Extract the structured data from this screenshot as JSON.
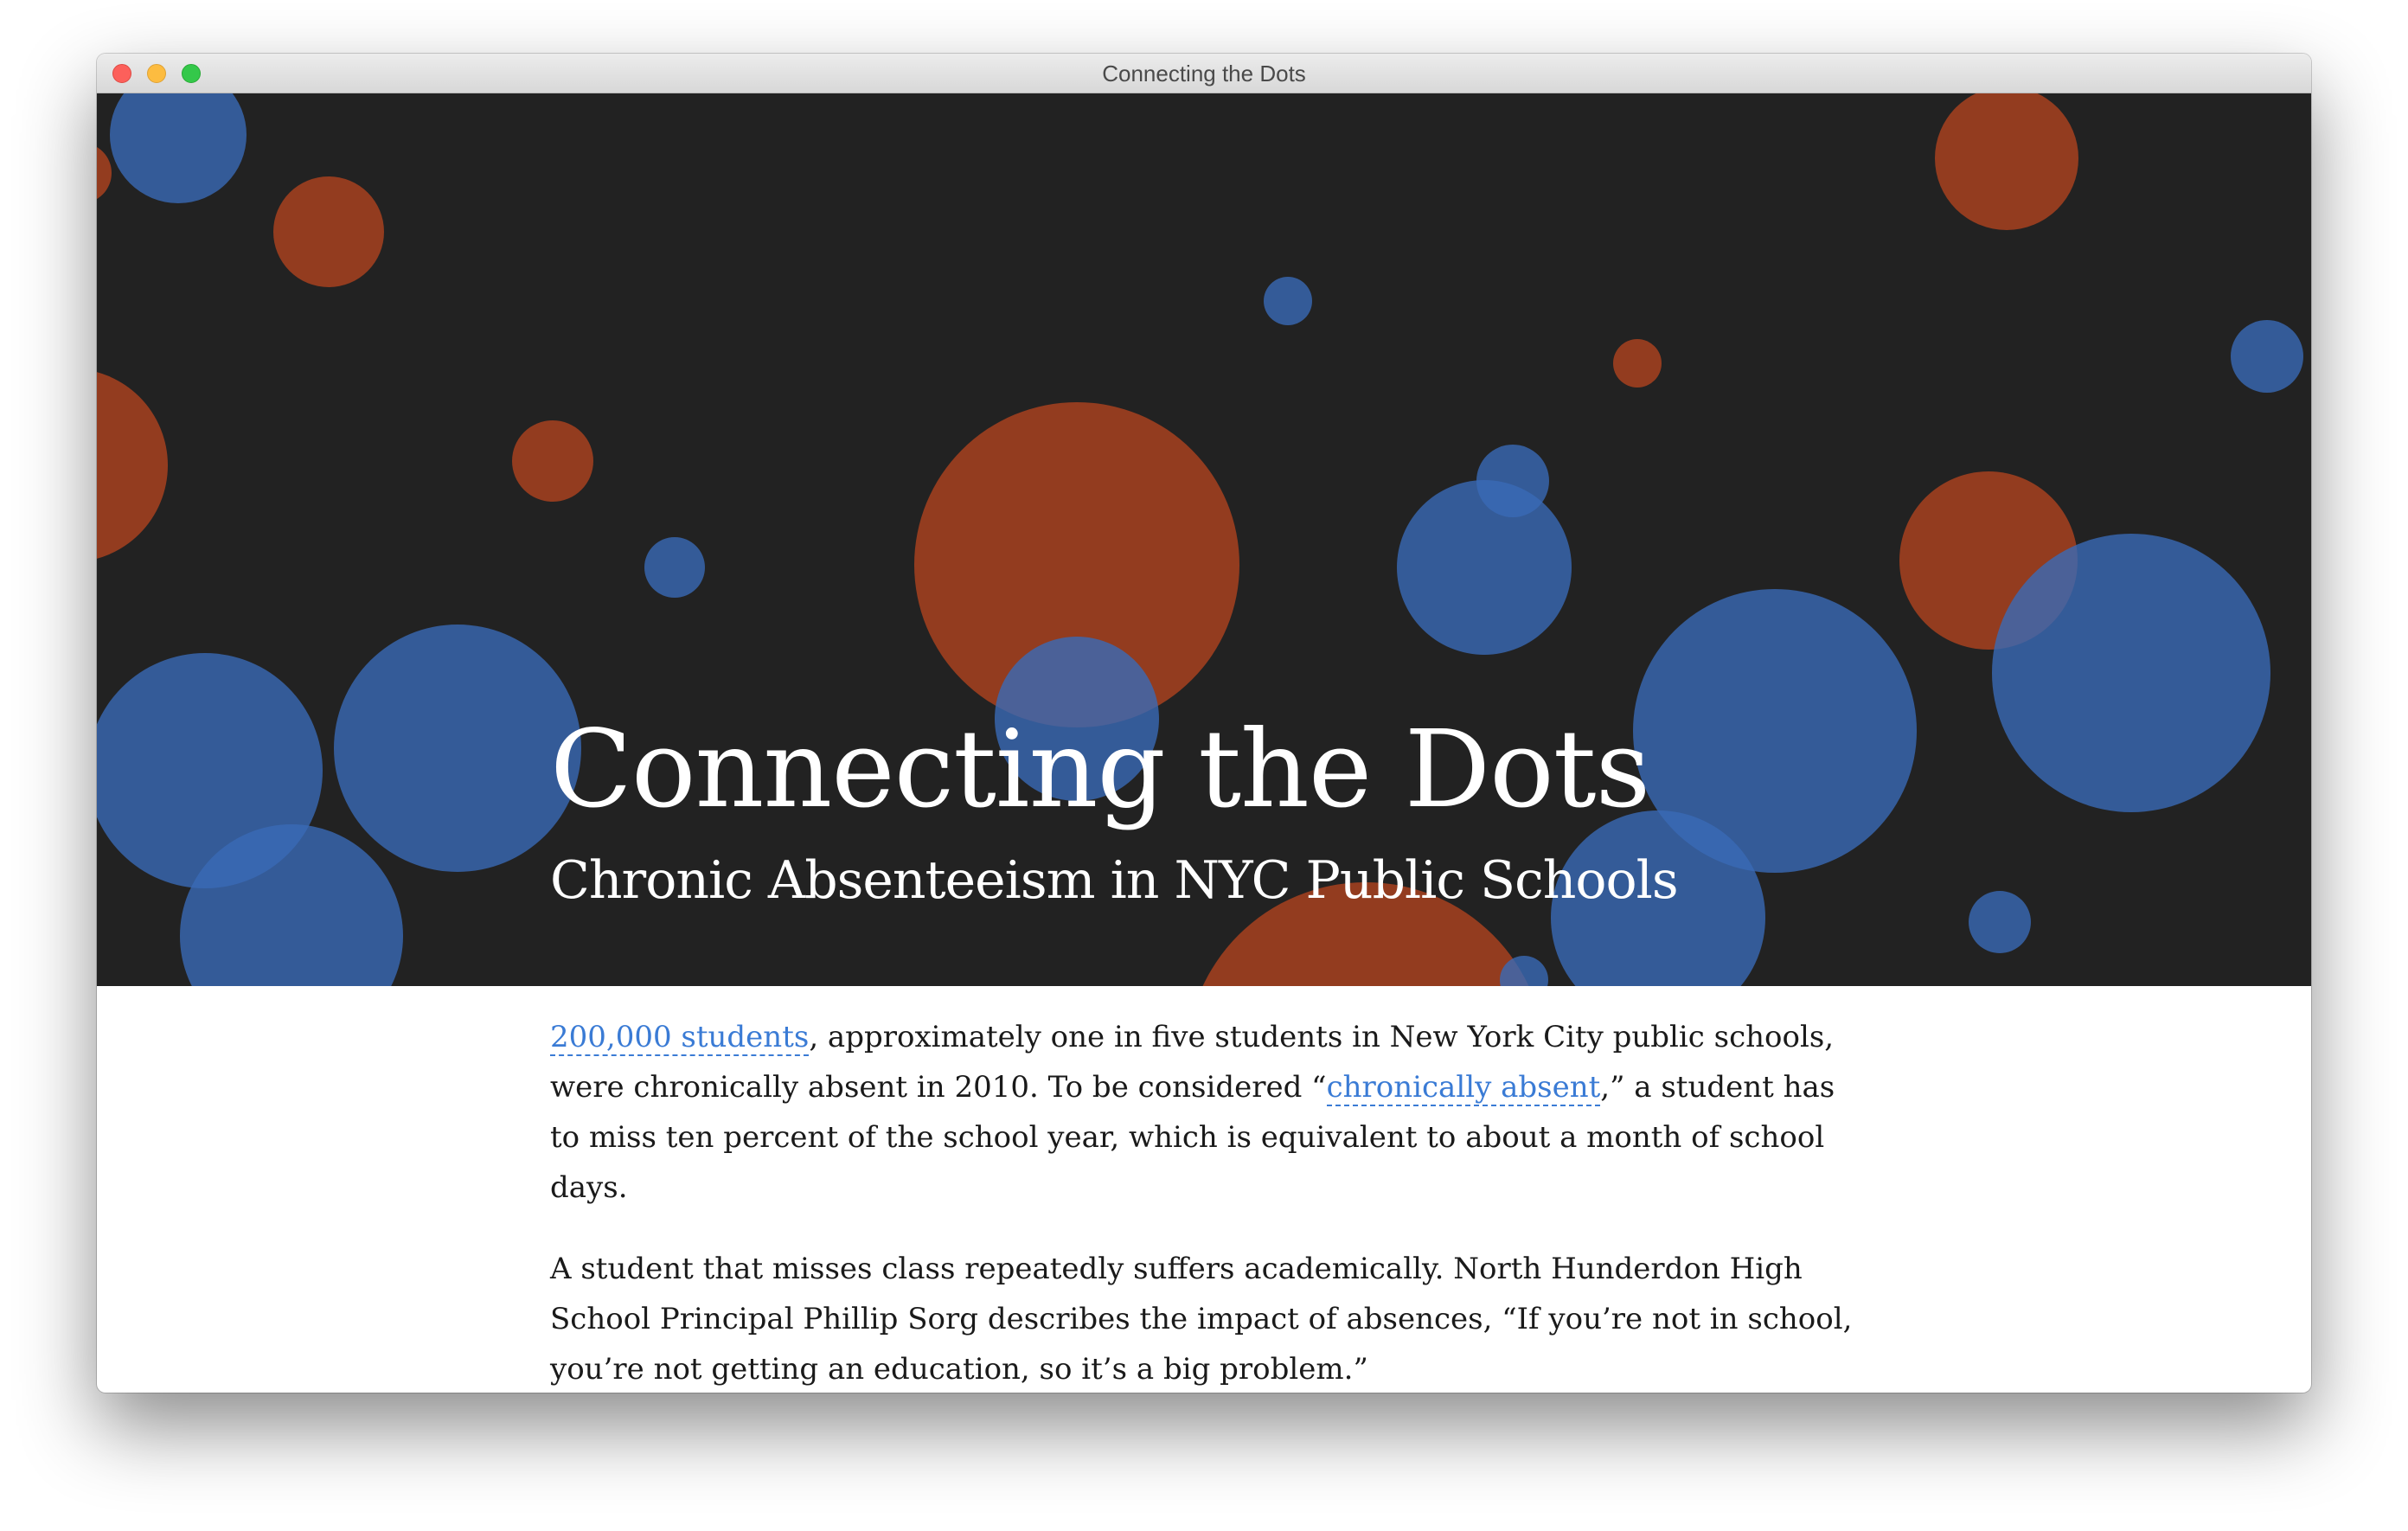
{
  "window": {
    "title": "Connecting the Dots"
  },
  "hero": {
    "title": "Connecting the Dots",
    "subtitle": "Chronic Absenteeism in NYC Public Schools",
    "colors": {
      "background": "#222222",
      "orange": "#a3401f",
      "blue": "#3a6ab7"
    }
  },
  "article": {
    "p1": {
      "link1": "200,000 students",
      "text1": ", approximately one in five students in New York City public schools, were chronically absent in 2010. To be considered “",
      "link2": "chronically absent",
      "text2": ",” a student has to miss ten percent of the school year, which is equivalent to about a month of school days."
    },
    "p2": "A student that misses class repeatedly suffers academically. North Hunderdon High School Principal Phillip Sorg describes the impact of absences, “If you’re not in school, you’re not getting an education, so it’s a big problem.”"
  }
}
